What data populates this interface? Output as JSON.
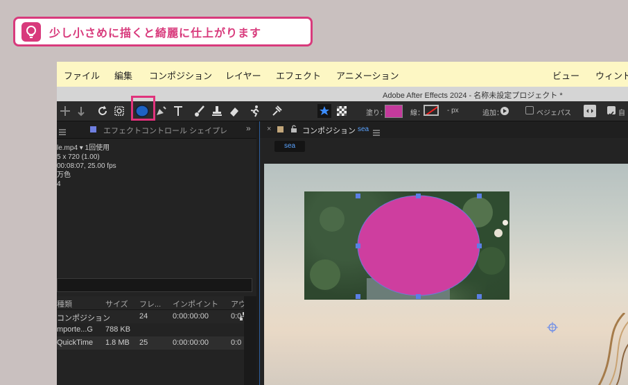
{
  "tip": {
    "text": "少し小さめに描くと綺麗に仕上がります",
    "icon": "lightbulb-icon",
    "accent": "#d83a7c"
  },
  "menubar": {
    "items": [
      "ファイル",
      "編集",
      "コンポジション",
      "レイヤー",
      "エフェクト",
      "アニメーション",
      "ビュー",
      "ウィンド"
    ]
  },
  "window": {
    "title": "Adobe After Effects 2024 - 名称未設定プロジェクト *"
  },
  "toolbar": {
    "fill_label": "塗り：",
    "stroke_label": "線：",
    "px_label": "- px",
    "add_label": "追加：",
    "bezier_label": "ベジェパス",
    "auto_label": "自",
    "fill_color": "#c43a9c",
    "highlight_color": "#e0337c"
  },
  "project": {
    "tab_effects": "エフェクトコントロール シェイプレ",
    "info_lines": [
      "le.mp4 ▾ 1回使用",
      "5 x 720 (1.00)",
      "00:08:07, 25.00 fps",
      "万色",
      "4"
    ],
    "columns": [
      "種類",
      "サイズ",
      "フレ...",
      "インポイント",
      "アウト"
    ],
    "rows": [
      {
        "type": "コンポジション",
        "size": "",
        "frame": "24",
        "in": "0:00:00:00",
        "out": "0:0"
      },
      {
        "type": "mporte...G",
        "size": "788 KB",
        "frame": "",
        "in": "",
        "out": ""
      },
      {
        "type": "QuickTime",
        "size": "1.8 MB",
        "frame": "25",
        "in": "0:00:00:00",
        "out": "0:0"
      }
    ]
  },
  "composition": {
    "panel_title": "コンポジション",
    "comp_name": "sea",
    "breadcrumb": "sea",
    "shape_color": "#ce3e9f",
    "handle_color": "#5b7fe6"
  }
}
